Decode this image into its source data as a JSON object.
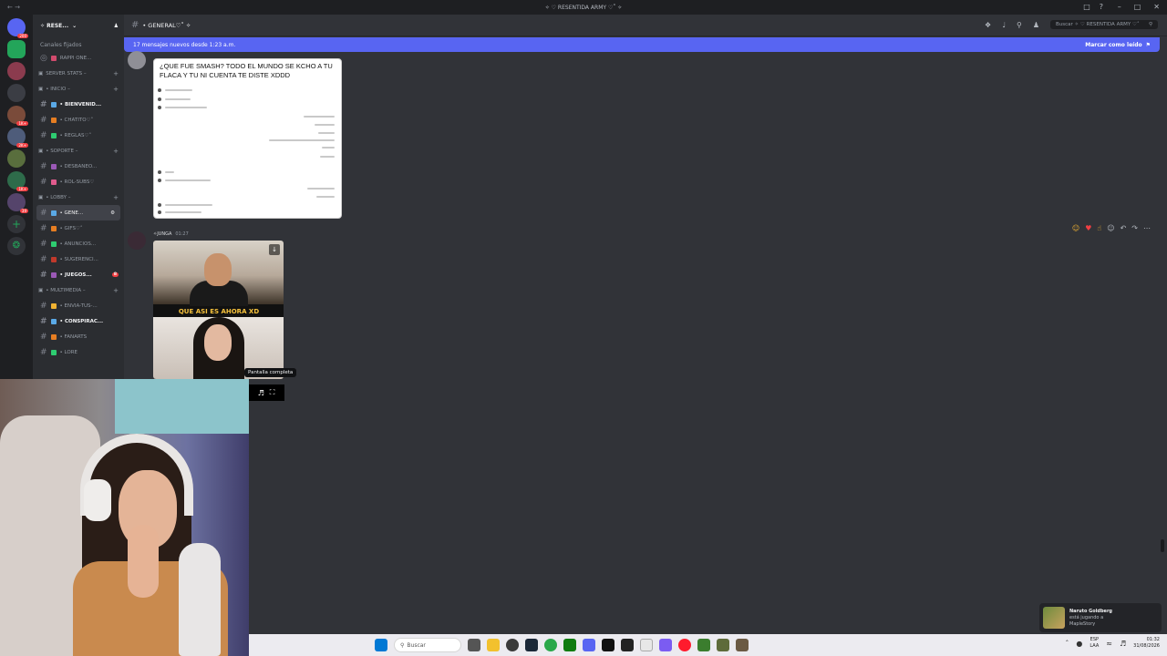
{
  "window": {
    "title": "✧ ♡ RESENTIDA ARMY ♡˚ ✧"
  },
  "server": {
    "name": "✧ RESE..."
  },
  "sidebar": {
    "pinned_label": "Canales fijados",
    "pinned_channel": "RAPPI ONE...",
    "items": [
      {
        "type": "category",
        "label": "SERVER STATS –"
      },
      {
        "type": "category",
        "label": "• INICIO –"
      },
      {
        "type": "channel",
        "label": "• BIENVENID...",
        "unread": true
      },
      {
        "type": "channel",
        "label": "• CHATITO♡˚"
      },
      {
        "type": "channel",
        "label": "• REGLAS♡˚"
      },
      {
        "type": "category",
        "label": "• SOPORTE –"
      },
      {
        "type": "channel",
        "label": "• DESBANEO..."
      },
      {
        "type": "channel",
        "label": "• ROL-SUBS♡"
      },
      {
        "type": "category",
        "label": "• LOBBY –"
      },
      {
        "type": "channel",
        "label": "• GENE...",
        "active": true
      },
      {
        "type": "channel",
        "label": "• GIFS♡˚"
      },
      {
        "type": "channel",
        "label": "• ANUNCIOS..."
      },
      {
        "type": "channel",
        "label": "• SUGERENCI..."
      },
      {
        "type": "channel",
        "label": "• JUEGOS...",
        "unread": true,
        "count": "8"
      },
      {
        "type": "category",
        "label": "• MULTIMEDIA –"
      },
      {
        "type": "channel",
        "label": "• ENVIA-TUS-..."
      },
      {
        "type": "channel",
        "label": "• CONSPIRAC...",
        "unread": true
      },
      {
        "type": "channel",
        "label": "• FANARTS"
      },
      {
        "type": "channel",
        "label": "• LORE"
      }
    ]
  },
  "header": {
    "channel": "• GENERAL♡˚ ✧",
    "search_placeholder": "Buscar ✧ ♡ RESENTIDA ARMY ♡˚"
  },
  "banner": {
    "text": "17 mensajes nuevos desde 1:23 a.m.",
    "action": "Marcar como leído"
  },
  "messages": [
    {
      "time": "01:27",
      "image_caption": "¿QUE FUE SMASH? TODO EL MUNDO SE KCHO A TU FLACA Y TU NI CUENTA TE DISTE XDDD"
    },
    {
      "role": "✧JUNGA",
      "time": "01:27",
      "video_caption": "QUE ASI ES AHORA XD"
    }
  ],
  "tooltip": "Pantalla completa",
  "toast": {
    "name": "Naruto Goldberg",
    "line1": "está jugando a",
    "line2": "MapleStory"
  },
  "taskbar": {
    "search_placeholder": "Buscar",
    "lang1": "ESP",
    "lang2": "LAA",
    "time": "01:32",
    "date": "31/08/2026"
  },
  "rail_badges": [
    "200",
    "1K+",
    "2K+",
    "1K+",
    "39"
  ],
  "colors": {
    "blurple": "#5865f2",
    "red": "#f23f43",
    "background": "#313338"
  }
}
